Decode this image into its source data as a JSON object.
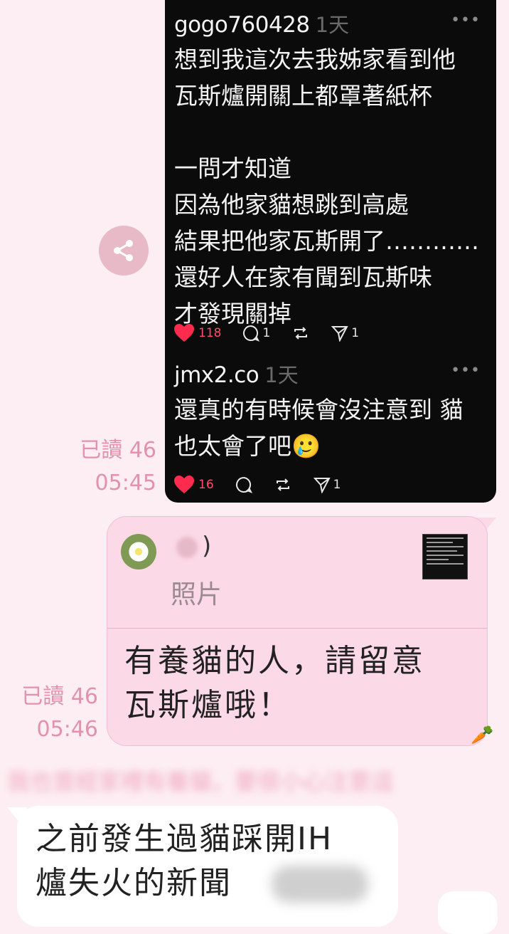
{
  "share_icon": "share-icon",
  "screenshot": {
    "posts": [
      {
        "user": "gogo760428",
        "time": "1天",
        "text": "想到我這次去我姊家看到他\n瓦斯爐開關上都罩著紙杯\n\n一問才知道\n因為他家貓想跳到高處\n結果把他家瓦斯開了…………\n還好人在家有聞到瓦斯味\n才發現關掉",
        "likes": "118",
        "comments": "1",
        "shares": "1"
      },
      {
        "user": "jmx2.co",
        "time": "1天",
        "text": "還真的有時候會沒注意到 貓\n也太會了吧🥲",
        "likes": "16",
        "shares": "1"
      }
    ]
  },
  "receipt1": {
    "read": "已讀 46",
    "time": "05:45"
  },
  "reply": {
    "quoted_name": ")",
    "quoted_type": "照片",
    "text": "有養貓的人，請留意\n瓦斯爐哦！",
    "read": "已讀 46",
    "time": "05:46"
  },
  "blurred_text": "我也曾經家裡有養貓，要很小心注意這",
  "incoming": {
    "text": "之前發生過貓踩開IH\n爐失火的新聞"
  },
  "colors": {
    "background": "#fdeef3",
    "bubble": "#fcd9e6",
    "receipt": "#e391ad",
    "like": "#ff4d6a"
  }
}
